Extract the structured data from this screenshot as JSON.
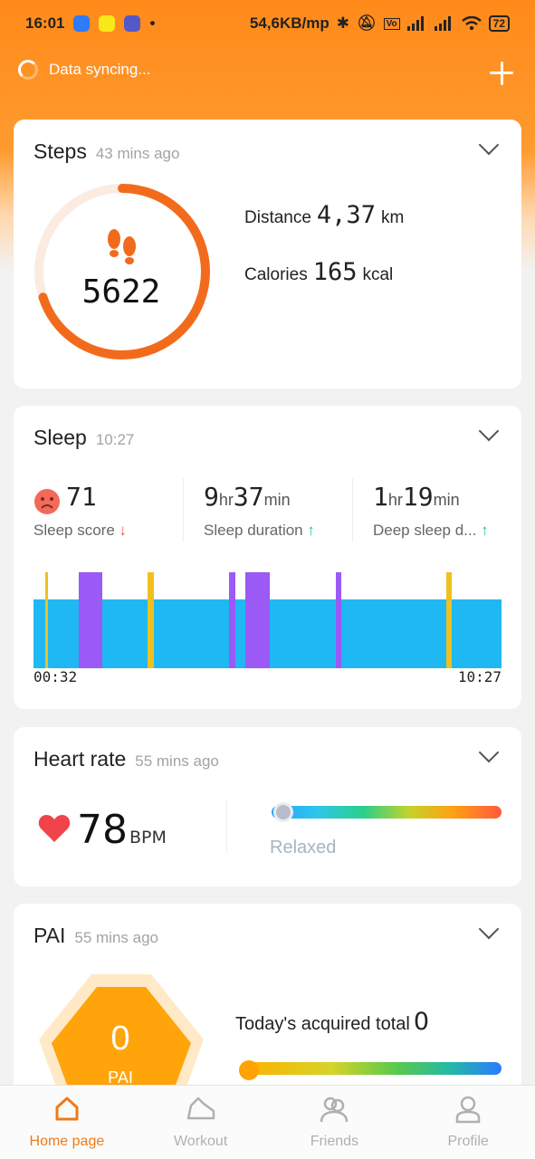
{
  "status_bar": {
    "time": "16:01",
    "network_speed": "54,6KB/mp",
    "battery": "72",
    "icons": [
      "messenger-icon",
      "snapchat-icon",
      "teams-icon",
      "bluetooth-icon",
      "mute-icon",
      "volte-icon",
      "signal-icon",
      "wifi-icon",
      "battery-icon"
    ]
  },
  "header": {
    "sync_text": "Data syncing...",
    "add_icon": "plus-icon"
  },
  "steps": {
    "title": "Steps",
    "time_ago": "43 mins ago",
    "count": "5622",
    "progress": 0.7,
    "distance_label": "Distance",
    "distance_value": "4,37",
    "distance_unit": "km",
    "calories_label": "Calories",
    "calories_value": "165",
    "calories_unit": "kcal",
    "accent": "#f26b1d"
  },
  "sleep": {
    "title": "Sleep",
    "time": "10:27",
    "score_value": "71",
    "score_label": "Sleep score",
    "score_trend": "↓",
    "duration_hr": "9",
    "duration_min": "37",
    "duration_label": "Sleep duration",
    "duration_trend": "↑",
    "deep_hr": "1",
    "deep_min": "19",
    "deep_label": "Deep sleep d...",
    "deep_trend": "↑",
    "unit_hr": "hr",
    "unit_min": "min",
    "start_time": "00:32",
    "end_time": "10:27",
    "colors": {
      "light": "#1fb8f2",
      "rem": "#9b59f5",
      "awake": "#f0c020"
    }
  },
  "heart_rate": {
    "title": "Heart rate",
    "time_ago": "55 mins ago",
    "value": "78",
    "unit": "BPM",
    "status": "Relaxed"
  },
  "pai": {
    "title": "PAI",
    "time_ago": "55 mins ago",
    "value": "0",
    "label": "PAI",
    "total_label": "Today's acquired total",
    "total_value": "0"
  },
  "bottom_nav": [
    {
      "label": "Home page",
      "icon": "home-icon",
      "active": true
    },
    {
      "label": "Workout",
      "icon": "shoe-icon",
      "active": false
    },
    {
      "label": "Friends",
      "icon": "friends-icon",
      "active": false
    },
    {
      "label": "Profile",
      "icon": "profile-icon",
      "active": false
    }
  ]
}
